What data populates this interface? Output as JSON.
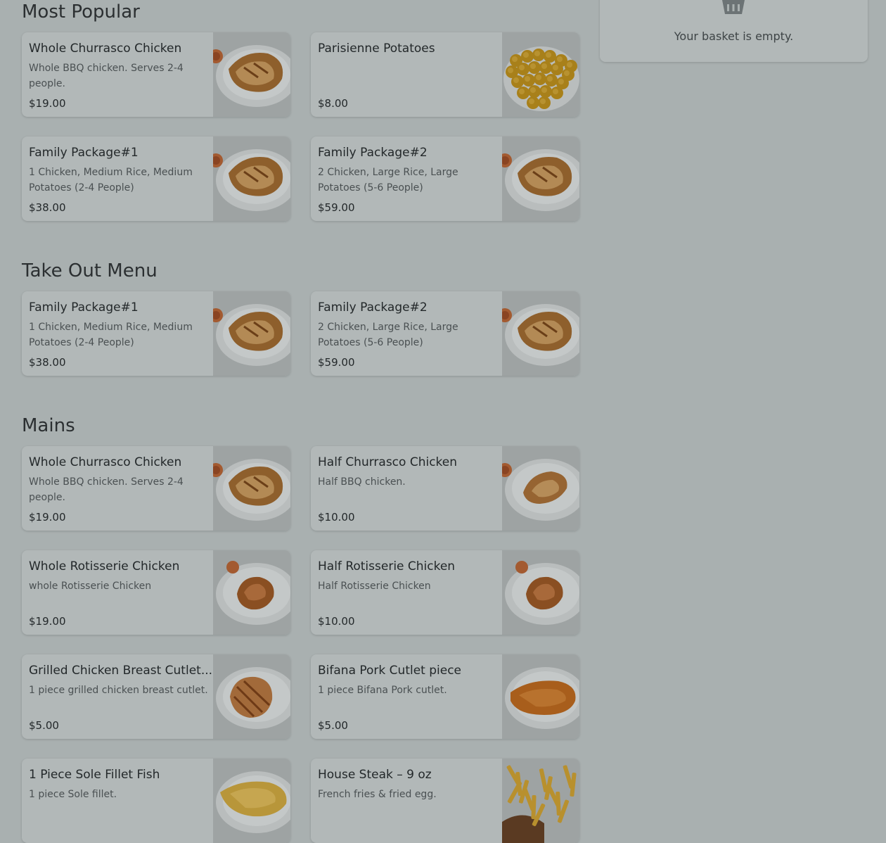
{
  "basket": {
    "empty_text": "Your basket is empty.",
    "icon": "basket-icon"
  },
  "sections": [
    {
      "title": "Most Popular",
      "items": [
        {
          "name": "Whole Churrasco Chicken",
          "desc": "Whole BBQ chicken. Serves 2-4 people.",
          "price": "$19.00",
          "image": "whole-chicken-plate"
        },
        {
          "name": "Parisienne Potatoes",
          "desc": "",
          "price": "$8.00",
          "image": "potato-balls"
        },
        {
          "name": "Family Package#1",
          "desc": "1 Chicken, Medium Rice, Medium Potatoes (2-4 People)",
          "price": "$38.00",
          "image": "whole-chicken-plate"
        },
        {
          "name": "Family Package#2",
          "desc": "2 Chicken, Large Rice, Large Potatoes (5-6 People)",
          "price": "$59.00",
          "image": "whole-chicken-plate"
        }
      ]
    },
    {
      "title": "Take Out Menu",
      "items": [
        {
          "name": "Family Package#1",
          "desc": "1 Chicken, Medium Rice, Medium Potatoes (2-4 People)",
          "price": "$38.00",
          "image": "whole-chicken-plate"
        },
        {
          "name": "Family Package#2",
          "desc": "2 Chicken, Large Rice, Large Potatoes (5-6 People)",
          "price": "$59.00",
          "image": "whole-chicken-plate"
        }
      ]
    },
    {
      "title": "Mains",
      "items": [
        {
          "name": "Whole Churrasco Chicken",
          "desc": "Whole BBQ chicken. Serves 2-4 people.",
          "price": "$19.00",
          "image": "whole-chicken-plate"
        },
        {
          "name": "Half Churrasco Chicken",
          "desc": "Half BBQ chicken.",
          "price": "$10.00",
          "image": "half-chicken-plate"
        },
        {
          "name": "Whole Rotisserie Chicken",
          "desc": "whole Rotisserie Chicken",
          "price": "$19.00",
          "image": "rotisserie-chicken-plate"
        },
        {
          "name": "Half Rotisserie Chicken",
          "desc": "Half Rotisserie Chicken",
          "price": "$10.00",
          "image": "rotisserie-chicken-plate"
        },
        {
          "name": "Grilled Chicken Breast Cutlet...",
          "desc": "1 piece grilled chicken breast cutlet.",
          "price": "$5.00",
          "image": "grilled-cutlet-plate"
        },
        {
          "name": "Bifana Pork Cutlet piece",
          "desc": "1 piece Bifana Pork cutlet.",
          "price": "$5.00",
          "image": "pork-cutlet-plate"
        },
        {
          "name": "1 Piece Sole Fillet Fish",
          "desc": "1 piece Sole fillet.",
          "price": "",
          "image": "fish-fillet-plate"
        },
        {
          "name": "House Steak – 9 oz",
          "desc": "French fries & fried egg.",
          "price": "",
          "image": "steak-fries-plate"
        }
      ]
    }
  ]
}
